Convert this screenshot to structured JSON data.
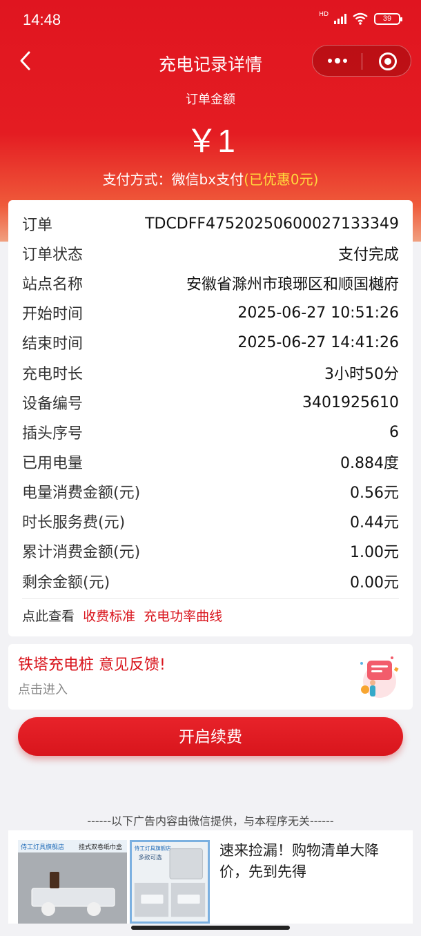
{
  "status_bar": {
    "time": "14:48",
    "network_label": "HD",
    "battery": "39",
    "icons": [
      "signal-icon",
      "wifi-icon",
      "battery-icon"
    ]
  },
  "nav": {
    "title": "充电记录详情",
    "back_icon": "back-arrow-icon",
    "more_icon": "more-dots-icon",
    "close_icon": "target-circle-icon"
  },
  "summary": {
    "amount_label": "订单金额",
    "amount": "￥1",
    "pay_method": "支付方式：微信bx支付",
    "pay_discount": "(已优惠0元)"
  },
  "details": [
    {
      "label": "订单",
      "value": "TDCDFF4752025060002713​3349"
    },
    {
      "label": "订单状态",
      "value": "支付完成"
    },
    {
      "label": "站点名称",
      "value": "安徽省滁州市琅琊区和顺国樾府"
    },
    {
      "label": "开始时间",
      "value": "2025-06-27 10:51:26"
    },
    {
      "label": "结束时间",
      "value": "2025-06-27 14:41:26"
    },
    {
      "label": "充电时长",
      "value": "3小时50分"
    },
    {
      "label": "设备编号",
      "value": "3401925610"
    },
    {
      "label": "插头序号",
      "value": "6"
    },
    {
      "label": "已用电量",
      "value": "0.884度"
    },
    {
      "label": "电量消费金额(元)",
      "value": "0.56元"
    },
    {
      "label": "时长服务费(元)",
      "value": "0.44元"
    },
    {
      "label": "累计消费金额(元)",
      "value": "1.00元"
    },
    {
      "label": "剩余金额(元)",
      "value": "0.00元"
    }
  ],
  "links": {
    "prefix": "点此查看",
    "fee_standard": "收费标准",
    "power_curve": "充电功率曲线"
  },
  "feedback": {
    "title": "铁塔充电桩 意见反馈!",
    "subtitle": "点击进入"
  },
  "renew_button": "开启续费",
  "ad": {
    "notice": "------以下广告内容由微信提供，与本程序无关------",
    "text": "速来捡漏！购物清单大降价，先到先得",
    "shop_name": "侍工灯具旗舰店",
    "product_label": "挂式双卷纸巾盒",
    "tagline": "多款可选"
  },
  "colors": {
    "brand_red": "#e01520",
    "discount_yellow": "#ffd93d",
    "link_red": "#d9141c"
  }
}
